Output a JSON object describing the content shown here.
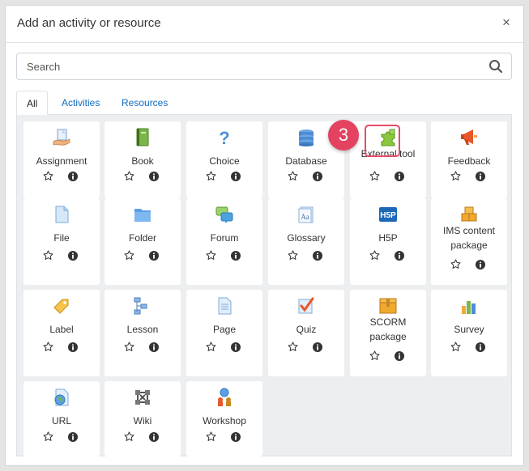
{
  "modal": {
    "title": "Add an activity or resource",
    "close_symbol": "×"
  },
  "search": {
    "placeholder": "Search",
    "icon": "search-icon"
  },
  "tabs": [
    {
      "label": "All",
      "active": true
    },
    {
      "label": "Activities",
      "active": false
    },
    {
      "label": "Resources",
      "active": false
    }
  ],
  "items": [
    {
      "label": "Assignment",
      "icon": "assignment-icon"
    },
    {
      "label": "Book",
      "icon": "book-icon"
    },
    {
      "label": "Choice",
      "icon": "choice-icon"
    },
    {
      "label": "Database",
      "icon": "database-icon"
    },
    {
      "label": "External tool",
      "icon": "puzzle-icon"
    },
    {
      "label": "Feedback",
      "icon": "megaphone-icon"
    },
    {
      "label": "File",
      "icon": "file-icon"
    },
    {
      "label": "Folder",
      "icon": "folder-icon"
    },
    {
      "label": "Forum",
      "icon": "forum-icon"
    },
    {
      "label": "Glossary",
      "icon": "glossary-icon"
    },
    {
      "label": "H5P",
      "icon": "h5p-icon"
    },
    {
      "label": "IMS content package",
      "icon": "ims-package-icon"
    },
    {
      "label": "Label",
      "icon": "tag-icon"
    },
    {
      "label": "Lesson",
      "icon": "lesson-icon"
    },
    {
      "label": "Page",
      "icon": "page-icon"
    },
    {
      "label": "Quiz",
      "icon": "quiz-icon"
    },
    {
      "label": "SCORM package",
      "icon": "scorm-icon"
    },
    {
      "label": "Survey",
      "icon": "survey-icon"
    },
    {
      "label": "URL",
      "icon": "url-icon"
    },
    {
      "label": "Wiki",
      "icon": "wiki-icon"
    },
    {
      "label": "Workshop",
      "icon": "workshop-icon"
    }
  ],
  "annotation": {
    "step_number": "3",
    "highlighted_item": "External tool",
    "color": "#e34261"
  },
  "colors": {
    "link": "#0f6cbf",
    "panel_background": "#eceef0"
  }
}
